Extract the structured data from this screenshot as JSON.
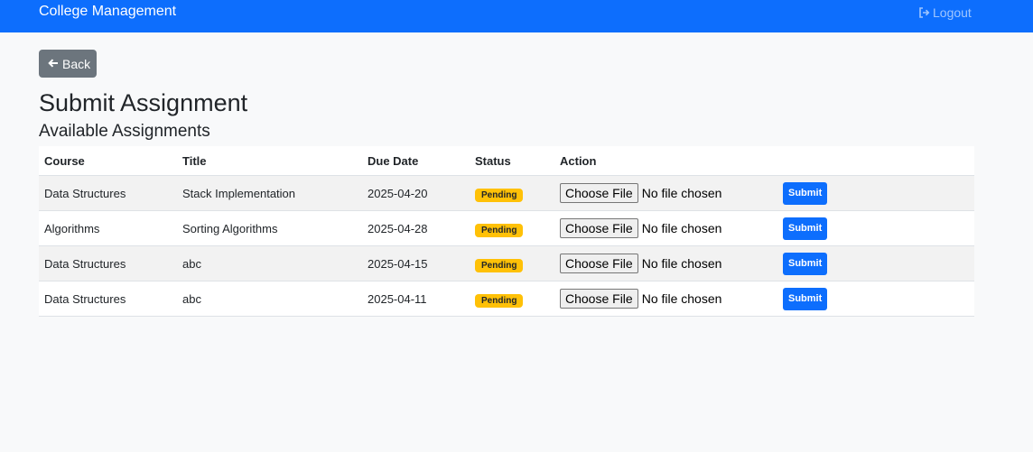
{
  "navbar": {
    "brand": "College Management",
    "logout_label": "Logout"
  },
  "back_button": {
    "label": "Back"
  },
  "page_title": "Submit Assignment",
  "section_title": "Available Assignments",
  "table": {
    "columns": [
      "Course",
      "Title",
      "Due Date",
      "Status",
      "Action"
    ],
    "rows": [
      {
        "course": "Data Structures",
        "title": "Stack Implementation",
        "due_date": "2025-04-20",
        "status": "Pending",
        "choose_label": "Choose File",
        "file_status": "No file chosen",
        "submit_label": "Submit"
      },
      {
        "course": "Algorithms",
        "title": "Sorting Algorithms",
        "due_date": "2025-04-28",
        "status": "Pending",
        "choose_label": "Choose File",
        "file_status": "No file chosen",
        "submit_label": "Submit"
      },
      {
        "course": "Data Structures",
        "title": "abc",
        "due_date": "2025-04-15",
        "status": "Pending",
        "choose_label": "Choose File",
        "file_status": "No file chosen",
        "submit_label": "Submit"
      },
      {
        "course": "Data Structures",
        "title": "abc",
        "due_date": "2025-04-11",
        "status": "Pending",
        "choose_label": "Choose File",
        "file_status": "No file chosen",
        "submit_label": "Submit"
      }
    ]
  },
  "icons": {
    "back": "arrow-left-icon",
    "logout": "sign-out-icon"
  },
  "colors": {
    "primary": "#0d6efd",
    "secondary": "#6c757d",
    "warning": "#ffc107",
    "background": "#f8f9fa"
  }
}
